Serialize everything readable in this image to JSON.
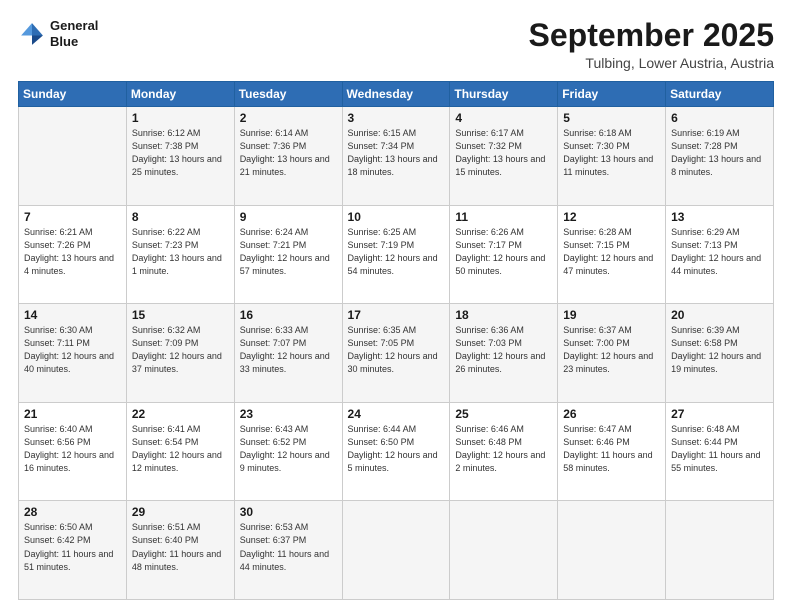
{
  "header": {
    "logo_line1": "General",
    "logo_line2": "Blue",
    "month": "September 2025",
    "location": "Tulbing, Lower Austria, Austria"
  },
  "weekdays": [
    "Sunday",
    "Monday",
    "Tuesday",
    "Wednesday",
    "Thursday",
    "Friday",
    "Saturday"
  ],
  "weeks": [
    [
      {
        "day": "",
        "sunrise": "",
        "sunset": "",
        "daylight": ""
      },
      {
        "day": "1",
        "sunrise": "Sunrise: 6:12 AM",
        "sunset": "Sunset: 7:38 PM",
        "daylight": "Daylight: 13 hours and 25 minutes."
      },
      {
        "day": "2",
        "sunrise": "Sunrise: 6:14 AM",
        "sunset": "Sunset: 7:36 PM",
        "daylight": "Daylight: 13 hours and 21 minutes."
      },
      {
        "day": "3",
        "sunrise": "Sunrise: 6:15 AM",
        "sunset": "Sunset: 7:34 PM",
        "daylight": "Daylight: 13 hours and 18 minutes."
      },
      {
        "day": "4",
        "sunrise": "Sunrise: 6:17 AM",
        "sunset": "Sunset: 7:32 PM",
        "daylight": "Daylight: 13 hours and 15 minutes."
      },
      {
        "day": "5",
        "sunrise": "Sunrise: 6:18 AM",
        "sunset": "Sunset: 7:30 PM",
        "daylight": "Daylight: 13 hours and 11 minutes."
      },
      {
        "day": "6",
        "sunrise": "Sunrise: 6:19 AM",
        "sunset": "Sunset: 7:28 PM",
        "daylight": "Daylight: 13 hours and 8 minutes."
      }
    ],
    [
      {
        "day": "7",
        "sunrise": "Sunrise: 6:21 AM",
        "sunset": "Sunset: 7:26 PM",
        "daylight": "Daylight: 13 hours and 4 minutes."
      },
      {
        "day": "8",
        "sunrise": "Sunrise: 6:22 AM",
        "sunset": "Sunset: 7:23 PM",
        "daylight": "Daylight: 13 hours and 1 minute."
      },
      {
        "day": "9",
        "sunrise": "Sunrise: 6:24 AM",
        "sunset": "Sunset: 7:21 PM",
        "daylight": "Daylight: 12 hours and 57 minutes."
      },
      {
        "day": "10",
        "sunrise": "Sunrise: 6:25 AM",
        "sunset": "Sunset: 7:19 PM",
        "daylight": "Daylight: 12 hours and 54 minutes."
      },
      {
        "day": "11",
        "sunrise": "Sunrise: 6:26 AM",
        "sunset": "Sunset: 7:17 PM",
        "daylight": "Daylight: 12 hours and 50 minutes."
      },
      {
        "day": "12",
        "sunrise": "Sunrise: 6:28 AM",
        "sunset": "Sunset: 7:15 PM",
        "daylight": "Daylight: 12 hours and 47 minutes."
      },
      {
        "day": "13",
        "sunrise": "Sunrise: 6:29 AM",
        "sunset": "Sunset: 7:13 PM",
        "daylight": "Daylight: 12 hours and 44 minutes."
      }
    ],
    [
      {
        "day": "14",
        "sunrise": "Sunrise: 6:30 AM",
        "sunset": "Sunset: 7:11 PM",
        "daylight": "Daylight: 12 hours and 40 minutes."
      },
      {
        "day": "15",
        "sunrise": "Sunrise: 6:32 AM",
        "sunset": "Sunset: 7:09 PM",
        "daylight": "Daylight: 12 hours and 37 minutes."
      },
      {
        "day": "16",
        "sunrise": "Sunrise: 6:33 AM",
        "sunset": "Sunset: 7:07 PM",
        "daylight": "Daylight: 12 hours and 33 minutes."
      },
      {
        "day": "17",
        "sunrise": "Sunrise: 6:35 AM",
        "sunset": "Sunset: 7:05 PM",
        "daylight": "Daylight: 12 hours and 30 minutes."
      },
      {
        "day": "18",
        "sunrise": "Sunrise: 6:36 AM",
        "sunset": "Sunset: 7:03 PM",
        "daylight": "Daylight: 12 hours and 26 minutes."
      },
      {
        "day": "19",
        "sunrise": "Sunrise: 6:37 AM",
        "sunset": "Sunset: 7:00 PM",
        "daylight": "Daylight: 12 hours and 23 minutes."
      },
      {
        "day": "20",
        "sunrise": "Sunrise: 6:39 AM",
        "sunset": "Sunset: 6:58 PM",
        "daylight": "Daylight: 12 hours and 19 minutes."
      }
    ],
    [
      {
        "day": "21",
        "sunrise": "Sunrise: 6:40 AM",
        "sunset": "Sunset: 6:56 PM",
        "daylight": "Daylight: 12 hours and 16 minutes."
      },
      {
        "day": "22",
        "sunrise": "Sunrise: 6:41 AM",
        "sunset": "Sunset: 6:54 PM",
        "daylight": "Daylight: 12 hours and 12 minutes."
      },
      {
        "day": "23",
        "sunrise": "Sunrise: 6:43 AM",
        "sunset": "Sunset: 6:52 PM",
        "daylight": "Daylight: 12 hours and 9 minutes."
      },
      {
        "day": "24",
        "sunrise": "Sunrise: 6:44 AM",
        "sunset": "Sunset: 6:50 PM",
        "daylight": "Daylight: 12 hours and 5 minutes."
      },
      {
        "day": "25",
        "sunrise": "Sunrise: 6:46 AM",
        "sunset": "Sunset: 6:48 PM",
        "daylight": "Daylight: 12 hours and 2 minutes."
      },
      {
        "day": "26",
        "sunrise": "Sunrise: 6:47 AM",
        "sunset": "Sunset: 6:46 PM",
        "daylight": "Daylight: 11 hours and 58 minutes."
      },
      {
        "day": "27",
        "sunrise": "Sunrise: 6:48 AM",
        "sunset": "Sunset: 6:44 PM",
        "daylight": "Daylight: 11 hours and 55 minutes."
      }
    ],
    [
      {
        "day": "28",
        "sunrise": "Sunrise: 6:50 AM",
        "sunset": "Sunset: 6:42 PM",
        "daylight": "Daylight: 11 hours and 51 minutes."
      },
      {
        "day": "29",
        "sunrise": "Sunrise: 6:51 AM",
        "sunset": "Sunset: 6:40 PM",
        "daylight": "Daylight: 11 hours and 48 minutes."
      },
      {
        "day": "30",
        "sunrise": "Sunrise: 6:53 AM",
        "sunset": "Sunset: 6:37 PM",
        "daylight": "Daylight: 11 hours and 44 minutes."
      },
      {
        "day": "",
        "sunrise": "",
        "sunset": "",
        "daylight": ""
      },
      {
        "day": "",
        "sunrise": "",
        "sunset": "",
        "daylight": ""
      },
      {
        "day": "",
        "sunrise": "",
        "sunset": "",
        "daylight": ""
      },
      {
        "day": "",
        "sunrise": "",
        "sunset": "",
        "daylight": ""
      }
    ]
  ]
}
